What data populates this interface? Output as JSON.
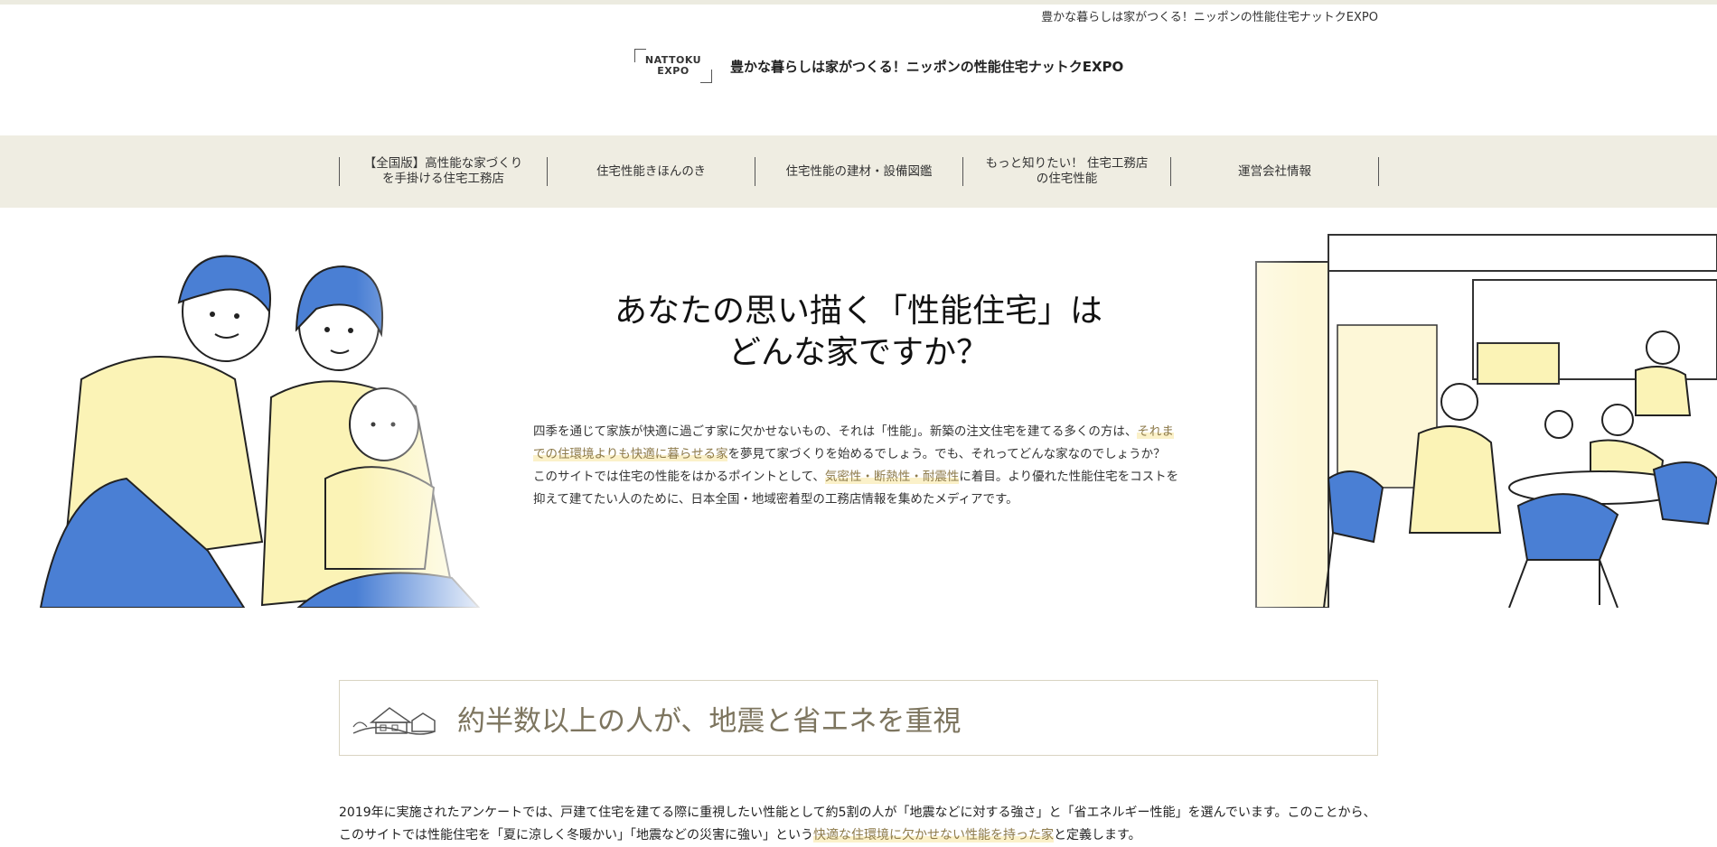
{
  "header": {
    "tagline": "豊かな暮らしは家がつくる！ニッポンの性能住宅ナットクEXPO",
    "logo_line1": "NATTOKU",
    "logo_line2": "EXPO",
    "site_title": "豊かな暮らしは家がつくる！ニッポンの性能住宅ナットクEXPO"
  },
  "nav": {
    "items": [
      {
        "label": "【全国版】高性能な家づくり\nを手掛ける住宅工務店"
      },
      {
        "label": "住宅性能きほんのき"
      },
      {
        "label": "住宅性能の建材・設備図鑑"
      },
      {
        "label": "もっと知りたい！ 住宅工務店\nの住宅性能"
      },
      {
        "label": "運営会社情報"
      }
    ]
  },
  "hero": {
    "title_line1": "あなたの思い描く「性能住宅」は",
    "title_line2": "どんな家ですか？",
    "p1_a": "四季を通じて家族が快適に過ごす家に欠かせないもの、それは「性能」。新築の注文住宅を建てる多くの方は、",
    "p1_hl": "それまでの住環境よりも快適に暮らせる家",
    "p1_b": "を夢見て家づくりを始めるでしょう。でも、それってどんな家なのでしょうか？",
    "p2_a": "このサイトでは住宅の性能をはかるポイントとして、",
    "p2_hl": "気密性・断熱性・耐震性",
    "p2_b": "に着目。より優れた性能住宅をコストを抑えて建てたい人のために、日本全国・地域密着型の工務店情報を集めたメディアです。"
  },
  "section": {
    "title": "約半数以上の人が、地震と省エネを重視",
    "p_a": "2019年に実施されたアンケートでは、戸建て住宅を建てる際に重視したい性能として約5割の人が「地震などに対する強さ」と「省エネルギー性能」を選んでいます。このことから、このサイトでは性能住宅を「夏に涼しく冬暖かい」「地震などの災害に強い」という",
    "p_hl": "快適な住環境に欠かせない性能を持った家",
    "p_b": "と定義します。"
  },
  "colors": {
    "nav_bg": "#efede2",
    "accent_blue": "#4a7fd4",
    "accent_yellow": "#fbf1c9",
    "heading_brown": "#7d755f"
  }
}
